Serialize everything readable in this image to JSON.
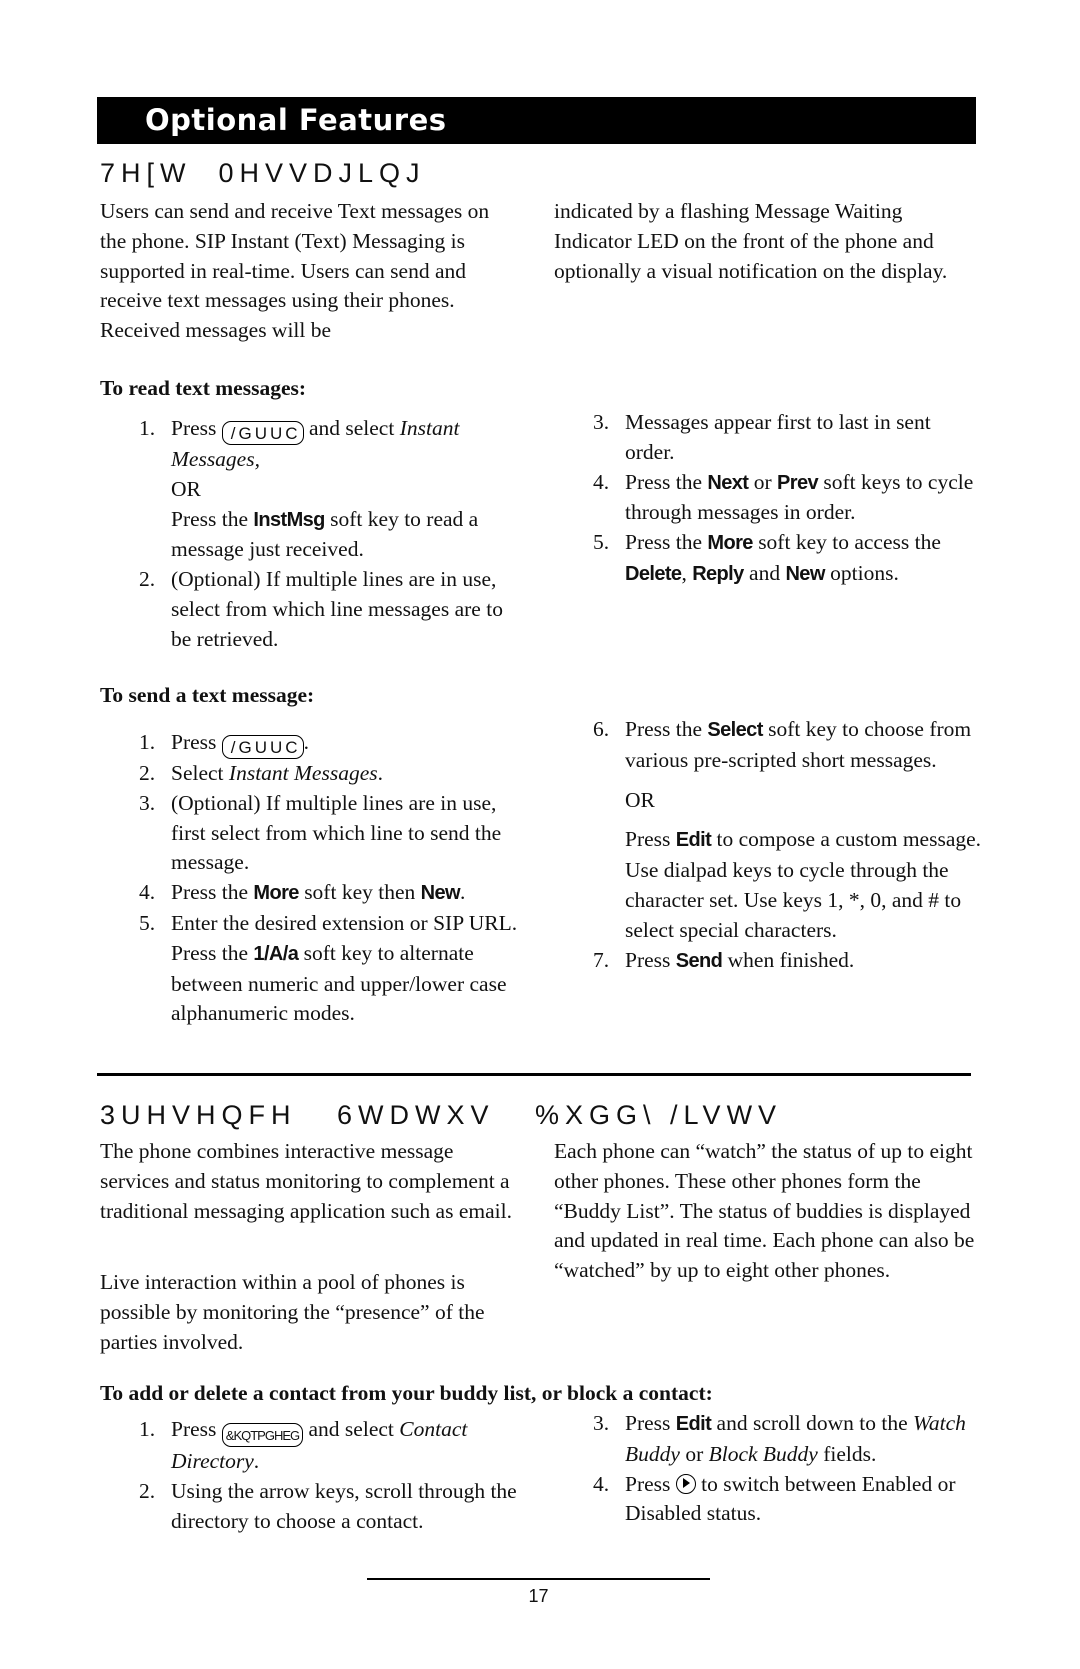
{
  "banner": "Optional Features",
  "text_messaging": {
    "heading": "7H[W  0HVVDJLQJ",
    "intro_left": "Users can send and receive Text messages on the phone.  SIP Instant (Text) Messaging is supported in real-time.  Users can send and receive text messages using their phones.  Received messages will be",
    "intro_right": "indicated by a flashing Message Waiting Indicator LED on the front of the phone and optionally a visual notification on the display.",
    "read": {
      "title": "To read text messages:",
      "s1_num": "1.",
      "s1_a": "Press",
      "s1_key": "/GUUC",
      "s1_b": " and select ",
      "s1_c": "Instant Messages,",
      "s1_or": "OR",
      "s1_d": "Press the ",
      "s1_sk": "InstMsg",
      "s1_e": " soft key to read a message just received.",
      "s2_num": "2.",
      "s2": "(Optional)  If multiple lines are in use, select from which line messages are to be retrieved.",
      "s3_num": "3.",
      "s3": "Messages appear first to last in sent order.",
      "s4_num": "4.",
      "s4_a": "Press the ",
      "s4_sk1": "Next",
      "s4_b": " or ",
      "s4_sk2": "Prev",
      "s4_c": " soft keys to cycle through messages in order.",
      "s5_num": "5.",
      "s5_a": "Press the ",
      "s5_sk1": "More",
      "s5_b": " soft key to access the ",
      "s5_sk2": "Delete",
      "s5_c": ", ",
      "s5_sk3": "Reply",
      "s5_d": " and ",
      "s5_sk4": "New",
      "s5_e": " options."
    },
    "send": {
      "title": "To send a text message:",
      "s1_num": "1.",
      "s1_a": "Press ",
      "s1_key": "/GUUC",
      "s1_b": ".",
      "s2_num": "2.",
      "s2_a": "Select ",
      "s2_b": "Instant Messages",
      ".": "",
      "s2_c": ".",
      "s3_num": "3.",
      "s3": "(Optional)  If multiple lines are in use, first select from which line to send the message.",
      "s4_num": "4.",
      "s4_a": "Press the ",
      "s4_sk1": "More",
      "s4_b": " soft key then ",
      "s4_sk2": "New",
      "s4_c": ".",
      "s5_num": "5.",
      "s5_a": "Enter the desired extension or SIP URL.  Press the ",
      "s5_sk": "1/A/a",
      "s5_b": " soft key to alternate between numeric and upper/lower case alphanumeric modes.",
      "s6_num": "6.",
      "s6_a": "Press the ",
      "s6_sk": "Select",
      "s6_b": " soft key to choose from various pre-scripted short messages.",
      "s6_or": "OR",
      "s6_c": "Press ",
      "s6_sk2": "Edit",
      "s6_d": " to compose a custom message.  Use dialpad keys to cycle through the character set.  Use keys 1, *, 0, and # to select special characters.",
      "s7_num": "7.",
      "s7_a": "Press ",
      "s7_sk": "Send",
      "s7_b": " when finished."
    }
  },
  "presence": {
    "heading": "3UHVHQFH   6WDWXV   %XGG\\ /LVWV",
    "left_p1": "The phone combines interactive message services and status monitoring to complement a traditional messaging application such as email.",
    "left_p2": "Live interaction within a pool of phones is possible by monitoring the “presence” of the parties involved.",
    "right_p1": "Each phone can “watch” the status of up to eight other phones.  These other phones form the “Buddy List”.  The status of buddies is displayed and updated in real time.  Each phone can also be “watched” by up to eight other phones.",
    "buddy": {
      "title": "To add or delete a contact from your buddy list, or block a contact:",
      "s1_num": "1.",
      "s1_a": "Press ",
      "s1_key": "&KQTPGHEG",
      "s1_b": " and select ",
      "s1_c": "Contact Directory",
      "s1_d": ".",
      "s2_num": "2.",
      "s2": "Using the arrow keys, scroll through the directory to choose a contact.",
      "s3_num": "3.",
      "s3_a": "Press ",
      "s3_sk": "Edit",
      "s3_b": " and scroll down to the ",
      "s3_c": "Watch Buddy",
      "s3_d": " or ",
      "s3_e": "Block Buddy",
      "s3_f": " fields.",
      "s4_num": "4.",
      "s4_a": "Press ",
      "s4_b": " to switch between Enabled or Disabled status."
    }
  },
  "page_number": "17"
}
